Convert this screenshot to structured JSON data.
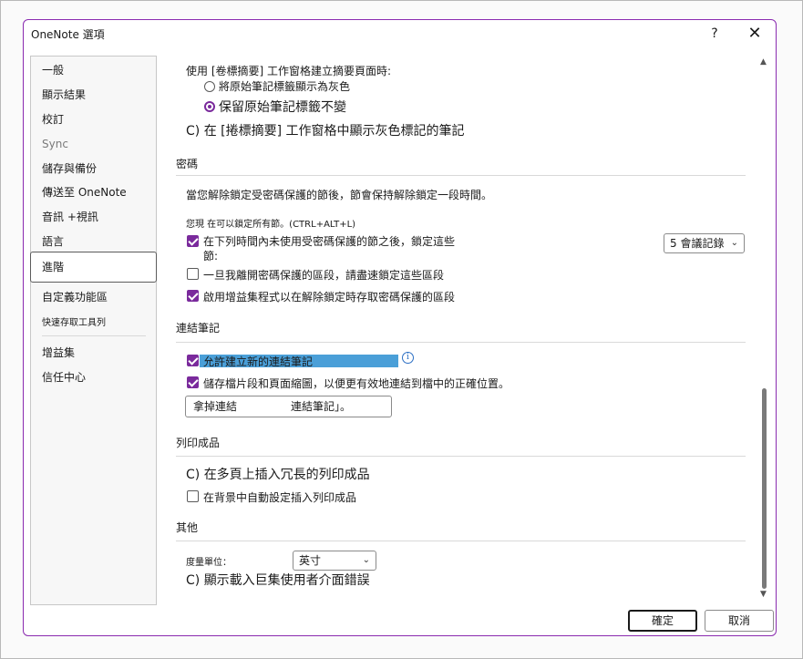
{
  "window": {
    "title": "OneNote 選項",
    "help": "?",
    "close": "✕"
  },
  "sidebar": {
    "items": [
      {
        "label": "一般"
      },
      {
        "label": "顯示結果"
      },
      {
        "label": "校訂"
      },
      {
        "label": "Sync"
      },
      {
        "label": "儲存與備份"
      },
      {
        "label": "傳送至 OneNote"
      },
      {
        "label": "音訊 +視訊"
      },
      {
        "label": "語言"
      },
      {
        "label": "進階"
      },
      {
        "label": "自定義功能區"
      },
      {
        "label": "快速存取工具列"
      },
      {
        "label": "增益集"
      },
      {
        "label": "信任中心"
      }
    ],
    "active_index": 8
  },
  "tags": {
    "heading": "使用 [卷標摘要] 工作窗格建立摘要頁面時:",
    "radio_gray": "將原始筆記標籤顯示為灰色",
    "radio_keep": "保留原始筆記標籤不變",
    "show_gray": "C) 在 [捲標摘要] 工作窗格中顯示灰色標記的筆記"
  },
  "password": {
    "heading": "密碼",
    "desc": "當您解除鎖定受密碼保護的節後，節會保持解除鎖定一段時間。",
    "lock_all": "您現 在可以鎖定所有節。(CTRL+ALT+L)",
    "lock_after_line1": "在下列時間內未使用受密碼保護的節之後，鎖定這些",
    "lock_after_line2": "節:",
    "lock_after_value": "5 會議記錄",
    "lock_on_leave": "一旦我離開密碼保護的區段，請盡速鎖定這些區段",
    "addins_access": "啟用增益集程式以在解除鎖定時存取密碼保護的區段"
  },
  "linked": {
    "heading": "連結筆記",
    "allow_new": "允許建立新的連結筆記",
    "info": "i",
    "save_snippets": "儲存檔片段和頁面縮圖，以便更有效地連結到檔中的正確位置。",
    "remove_label": "拿掉連結",
    "remove_suffix": "連結筆記」。"
  },
  "printouts": {
    "heading": "列印成品",
    "insert_long": "C) 在多頁上插入冗長的列印成品",
    "background": "在背景中自動設定插入列印成品"
  },
  "other": {
    "heading": "其他",
    "units_label": "度量單位：",
    "units_value": "英寸",
    "show_addin_errors": "C) 顯示載入巨集使用者介面錯誤"
  },
  "buttons": {
    "ok": "確定",
    "cancel": "取消"
  },
  "colors": {
    "accent": "#7a2a9c",
    "border": "#8a2bb0",
    "highlight": "#4a9fd8"
  },
  "icons": {
    "scroll_up": "▲",
    "scroll_down": "▼",
    "chevron": "⌄"
  }
}
